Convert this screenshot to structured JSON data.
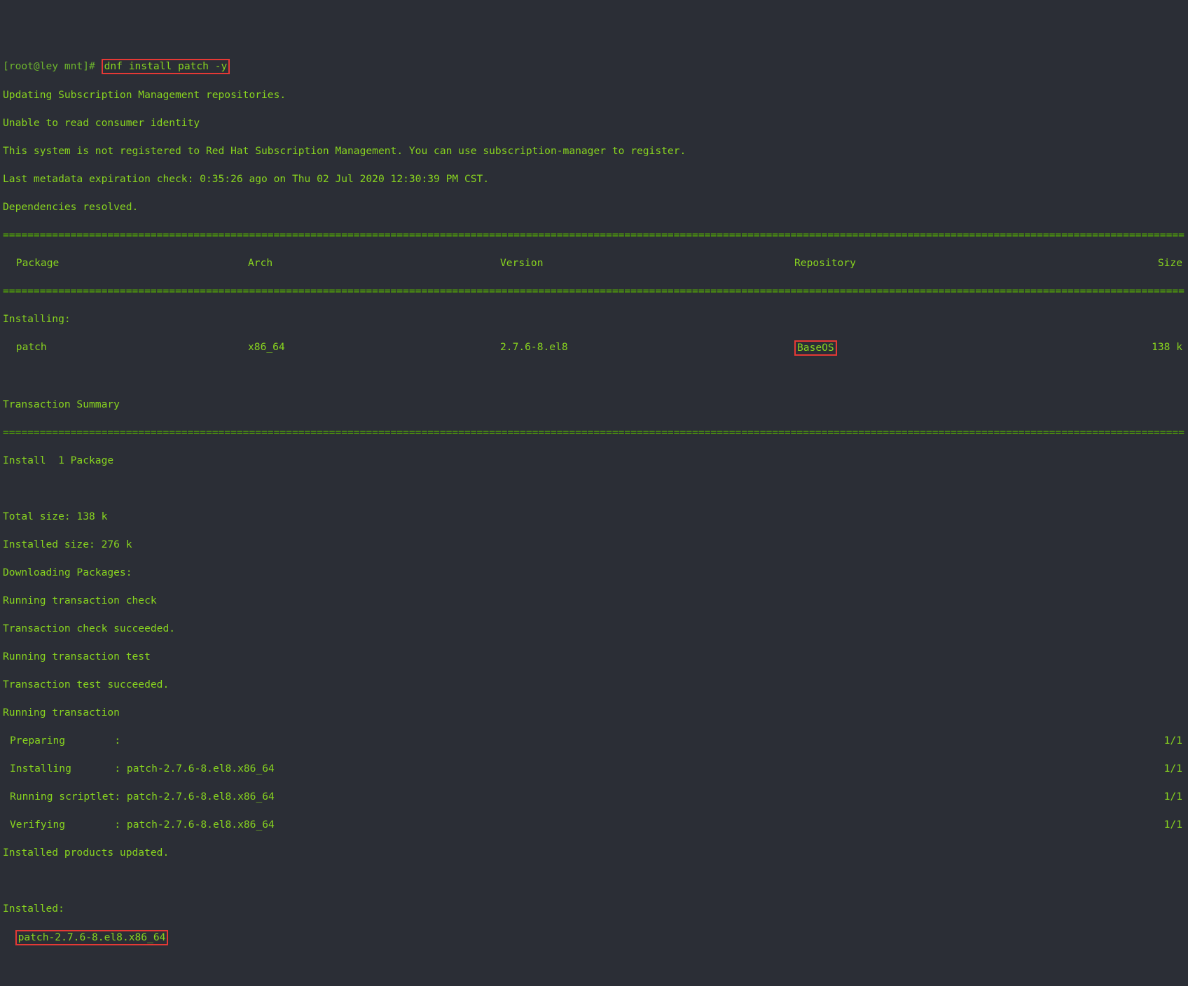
{
  "prompt": {
    "user_host": "[root@ley mnt]#",
    "command": "dnf install patch -y"
  },
  "lines1": {
    "l1": "Updating Subscription Management repositories.",
    "l2": "Unable to read consumer identity",
    "l3": "This system is not registered to Red Hat Subscription Management. You can use subscription-manager to register.",
    "l4": "Last metadata expiration check: 0:35:26 ago on Thu 02 Jul 2020 12:30:39 PM CST.",
    "l5": "Dependencies resolved."
  },
  "hr": "================================================================================================================================================================================================",
  "header": {
    "pkg": " Package",
    "arch": "Arch",
    "ver": "Version",
    "repo": "Repository",
    "size": "Size"
  },
  "install_hdr": "Installing:",
  "pkgrow": {
    "pkg": " patch",
    "arch": "x86_64",
    "ver": "2.7.6-8.el8",
    "repo": "BaseOS",
    "size": "138 k"
  },
  "tx": {
    "summary": "Transaction Summary",
    "pkgs": "Install  1 Package",
    "total": "Total size: 138 k",
    "instsize": "Installed size: 276 k",
    "dl": "Downloading Packages:",
    "chk": "Running transaction check",
    "chkok": "Transaction check succeeded.",
    "test": "Running transaction test",
    "testok": "Transaction test succeeded.",
    "run": "Running transaction",
    "prep": "Preparing        :",
    "inst": "Installing       : patch-2.7.6-8.el8.x86_64",
    "scr": "Running scriptlet: patch-2.7.6-8.el8.x86_64",
    "ver": "Verifying        : patch-2.7.6-8.el8.x86_64",
    "upd": "Installed products updated.",
    "count": "1/1"
  },
  "installed": {
    "hdr": "Installed:",
    "pkg": "patch-2.7.6-8.el8.x86_64"
  }
}
